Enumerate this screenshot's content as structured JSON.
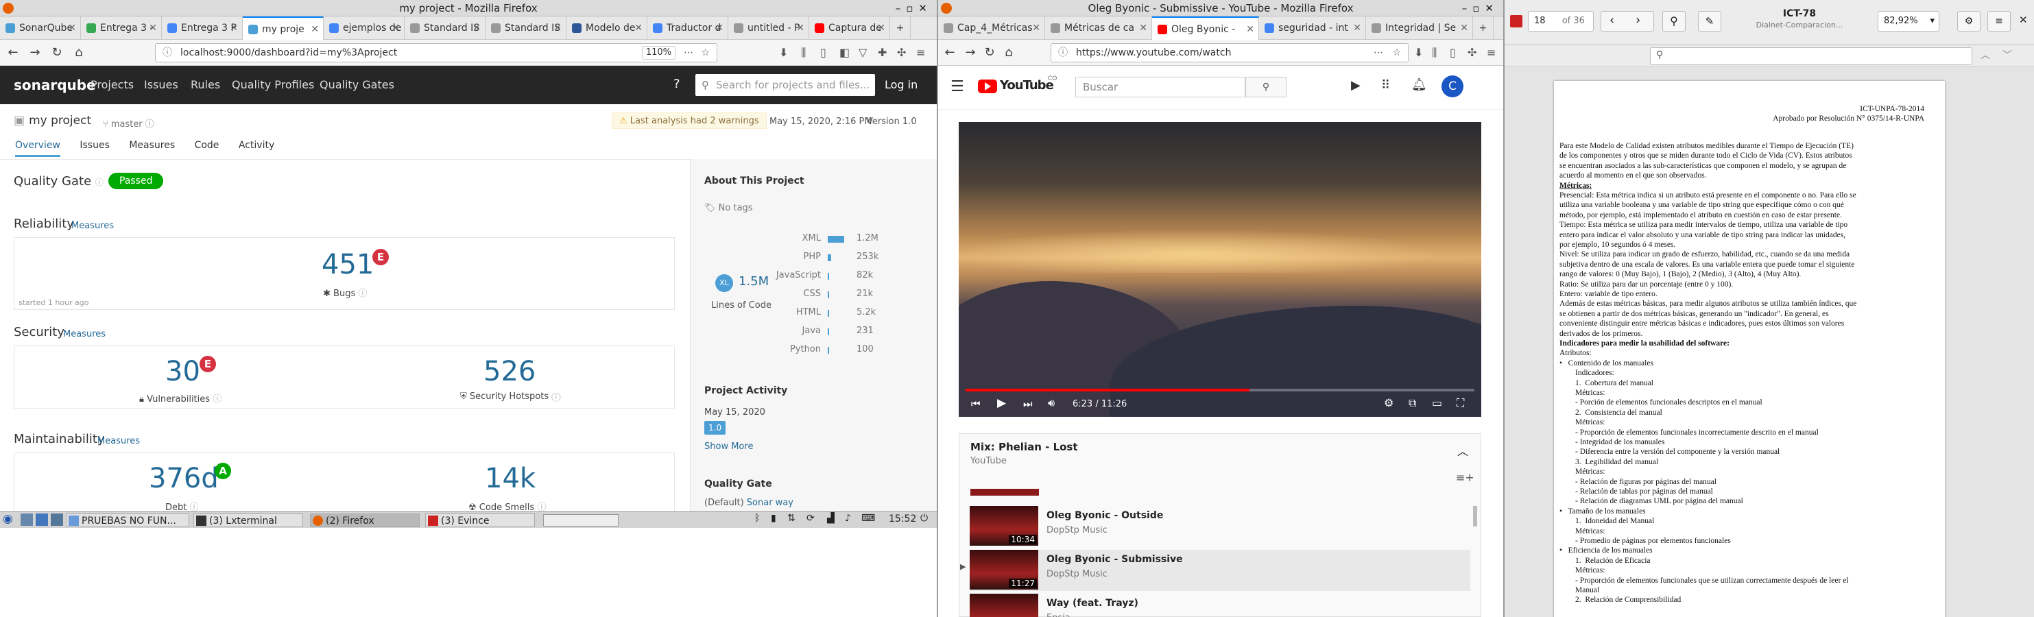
{
  "firefox_left": {
    "window_title": "my project - Mozilla Firefox",
    "tabs": [
      {
        "label": "SonarQube",
        "color": "#4b9fd5"
      },
      {
        "label": "Entrega 3 -",
        "color": "#34a853"
      },
      {
        "label": "Entrega 3 P",
        "color": "#4285f4"
      },
      {
        "label": "my proje",
        "color": "#4b9fd5"
      },
      {
        "label": "ejemplos de",
        "color": "#4285f4"
      },
      {
        "label": "Standard IS",
        "color": "#999999"
      },
      {
        "label": "Standard IS",
        "color": "#999999"
      },
      {
        "label": "Modelo de",
        "color": "#2b579a"
      },
      {
        "label": "Traductor d",
        "color": "#4285f4"
      },
      {
        "label": "untitled - P",
        "color": "#999999"
      },
      {
        "label": "Captura de",
        "color": "#ff0000"
      }
    ],
    "url": "localhost:9000/dashboard?id=my%3Aproject",
    "zoom": "110%",
    "sonar": {
      "logo": "sonarqube",
      "nav": [
        "Projects",
        "Issues",
        "Rules",
        "Quality Profiles",
        "Quality Gates"
      ],
      "search_placeholder": "Search for projects and files...",
      "login": "Log in",
      "project_name": "my project",
      "branch": "master",
      "warning": "Last analysis had 2 warnings",
      "analysis_date": "May 15, 2020, 2:16 PM",
      "version": "Version 1.0",
      "subnav": [
        "Overview",
        "Issues",
        "Measures",
        "Code",
        "Activity"
      ],
      "quality_gate_label": "Quality Gate",
      "quality_gate_status": "Passed",
      "reliability": {
        "title": "Reliability",
        "link": "Measures",
        "value": "451",
        "rating": "E",
        "label": "Bugs",
        "started": "started 1 hour ago"
      },
      "security": {
        "title": "Security",
        "link": "Measures",
        "vuln_value": "30",
        "vuln_rating": "E",
        "vuln_label": "Vulnerabilities",
        "hotspot_value": "526",
        "hotspot_label": "Security Hotspots"
      },
      "maintainability": {
        "title": "Maintainability",
        "link": "Measures",
        "debt_value": "376d",
        "debt_rating": "A",
        "debt_label": "Debt",
        "smells_value": "14k",
        "smells_label": "Code Smells"
      },
      "about_title": "About This Project",
      "no_tags": "No tags",
      "size_badge": "XL",
      "loc_value": "1.5M",
      "loc_label": "Lines of Code",
      "languages": [
        {
          "name": "XML",
          "value": "1.2M",
          "share": 0.8
        },
        {
          "name": "PHP",
          "value": "253k",
          "share": 0.17
        },
        {
          "name": "JavaScript",
          "value": "82k",
          "share": 0.06
        },
        {
          "name": "CSS",
          "value": "21k",
          "share": 0.02
        },
        {
          "name": "HTML",
          "value": "5.2k",
          "share": 0.01
        },
        {
          "name": "Java",
          "value": "231",
          "share": 0.005
        },
        {
          "name": "Python",
          "value": "100",
          "share": 0.005
        }
      ],
      "activity_title": "Project Activity",
      "activity_date": "May 15, 2020",
      "activity_version": "1.0",
      "show_more": "Show More",
      "qg_title": "Quality Gate",
      "qg_default": "(Default)",
      "qg_name": "Sonar way"
    }
  },
  "taskbar": {
    "items": [
      "PRUEBAS NO FUN...",
      "(3) Lxterminal",
      "(2) Firefox",
      "(3) Evince"
    ],
    "clock": "15:52"
  },
  "firefox_middle": {
    "window_title": "Oleg Byonic - Submissive - YouTube - Mozilla Firefox",
    "tabs": [
      {
        "label": "Cap_4_Métricas",
        "color": "#999999"
      },
      {
        "label": "Métricas de ca",
        "color": "#999999"
      },
      {
        "label": "Oleg Byonic -",
        "color": "#ff0000"
      },
      {
        "label": "seguridad - int",
        "color": "#4285f4"
      },
      {
        "label": "Integridad | Se",
        "color": "#999999"
      }
    ],
    "url": "https://www.youtube.com/watch",
    "youtube": {
      "logo": "YouTube",
      "country": "CO",
      "search_placeholder": "Buscar",
      "avatar_letter": "C",
      "time": "6:23 / 11:26",
      "progress": 0.558,
      "playlist_title": "Mix: Phelian - Lost",
      "playlist_channel": "YouTube",
      "items": [
        {
          "title": "Oleg Byonic - Outside",
          "channel": "DopStp Music",
          "duration": "10:34"
        },
        {
          "title": "Oleg Byonic - Submissive",
          "channel": "DopStp Music",
          "duration": "11:27"
        },
        {
          "title": "Way (feat. Trayz)",
          "channel": "Ensia",
          "duration": ""
        }
      ]
    }
  },
  "evince": {
    "window_title": "ICT-78",
    "subtitle": "Dialnet-Comparacion...",
    "page_current": "18",
    "page_total": "of 36",
    "zoom": "82,92%",
    "header_line1": "ICT-UNPA-78-2014",
    "header_line2": "Aprobado por Resolución N° 0375/14-R-UNPA",
    "lines": [
      "Para este Modelo de Calidad existen atributos medibles durante el Tiempo de Ejecución (TE)",
      "de los componentes y otros que se miden durante todo el Ciclo de Vida (CV). Estos atributos",
      "se encuentran asociados a las sub-características que componen el modelo, y se agrupan de",
      "acuerdo al momento en el que son observados.",
      "Métricas:",
      "Presencial: Esta métrica indica si un atributo está presente en el componente o no. Para ello se",
      "utiliza una variable booleana y una variable de tipo string que especifique cómo o con qué",
      "método, por ejemplo, está implementado el atributo en cuestión en caso de estar presente.",
      "Tiempo: Esta métrica se utiliza para medir intervalos de tiempo, utiliza una variable de tipo",
      "entero para indicar el valor absoluto y una variable de tipo string para indicar las unidades,",
      "por ejemplo, 10 segundos ó 4 meses.",
      "Nivel: Se utiliza para indicar un grado de esfuerzo, habilidad, etc., cuando se da una medida",
      "subjetiva dentro de una escala de valores. Es una variable entera que puede tomar el siguiente",
      "rango de valores: 0 (Muy Bajo), 1 (Bajo), 2 (Medio), 3 (Alto), 4 (Muy Alto).",
      "Ratio: Se utiliza para dar un porcentaje (entre 0 y 100).",
      "Entero: variable de tipo entero.",
      "Además de estas métricas básicas, para medir algunos atributos se utiliza también índices, que",
      "se obtienen a partir de dos métricas básicas, generando un \"indicador\". En general, es",
      "conveniente distinguir entre métricas básicas e indicadores, pues estos últimos son valores",
      "derivados de los primeros.",
      "Indicadores para medir la usabilidad del software:",
      "Atributos:",
      "•   Contenido de los manuales",
      "        Indicadores:",
      "        1.  Cobertura del manual",
      "        Métricas:",
      "        - Porción de elementos funcionales descriptos en el manual",
      "        2.  Consistencia del manual",
      "        Métricas:",
      "        - Proporción de elementos funcionales incorrectamente descrito en el manual",
      "        - Integridad de los manuales",
      "        - Diferencia entre la versión del componente y la versión manual",
      "        3.  Legibilidad del manual",
      "        Métricas:",
      "        - Relación de figuras por páginas del manual",
      "        - Relación de tablas por páginas del manual",
      "        - Relación de diagramas UML por página del manual",
      "•   Tamaño de los manuales",
      "        1.  Idoneidad del Manual",
      "        Métricas:",
      "        - Promedio de páginas por elementos funcionales",
      "•   Eficiencia de los manuales",
      "        1.  Relación de Eficacia",
      "        Métricas:",
      "        - Proporción de elementos funcionales que se utilizan correctamente después de leer el",
      "        Manual",
      "        2.  Relación de Comprensibilidad"
    ]
  }
}
